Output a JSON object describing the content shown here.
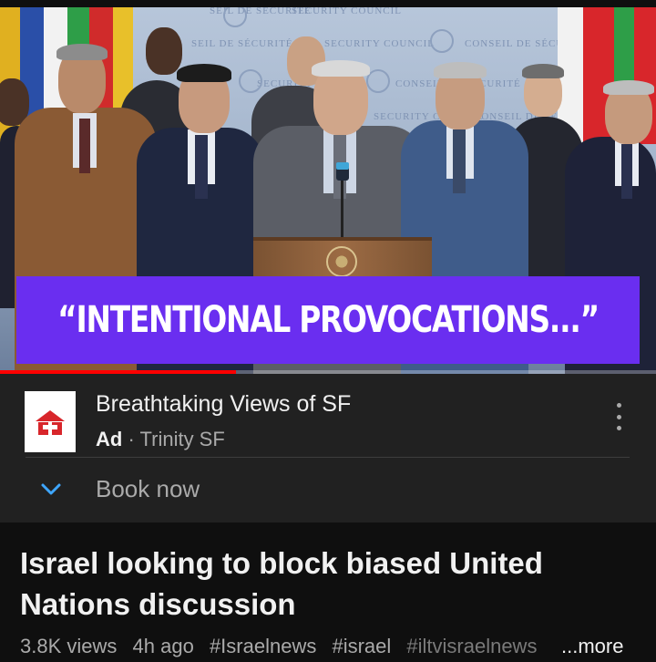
{
  "video": {
    "banner_text": "“INTENTIONAL PROVOCATIONS...”",
    "wall_text": [
      "SEIL DE SÉCURITÉ",
      "SECURITY COUNCIL",
      "CONSEIL DE SÉCU",
      "SECURITY COUNCIL",
      "CONSEIL DE SÉCURITÉ",
      "SECURITY COUNCIL",
      "CONSEIL DE SÉCURITÉ",
      "SECURITY COUNCIL",
      "CONSEIL DE SÉCURITÉ"
    ],
    "progress_fraction": 0.36,
    "colors": {
      "banner": "#6a2ef0",
      "progress": "#ff0000"
    }
  },
  "ad": {
    "logo_icon": "red-house-logo-icon",
    "title": "Breathtaking Views of SF",
    "ad_label": "Ad",
    "separator": "·",
    "advertiser": "Trinity SF",
    "menu_icon": "more-vert-icon",
    "expand_icon": "chevron-down-icon",
    "cta": "Book now"
  },
  "info": {
    "title": "Israel looking to block biased United Nations discussion",
    "views": "3.8K views",
    "age": "4h ago",
    "hashtags": [
      "#Israelnews",
      "#israel",
      "#iltvisraelnews"
    ],
    "more": "...more"
  }
}
